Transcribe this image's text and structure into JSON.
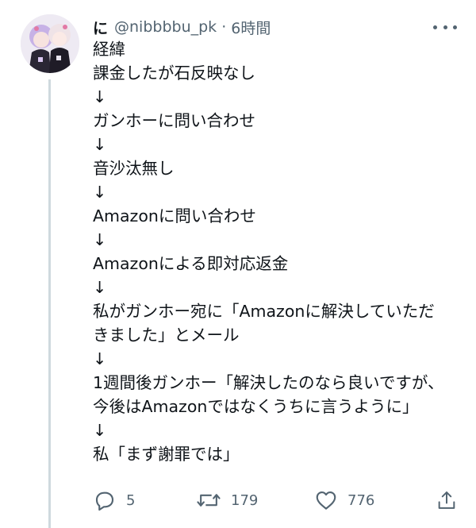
{
  "tweet": {
    "display_name": "に",
    "handle": "@nibbbbu_pk",
    "separator": "·",
    "time": "6時間",
    "body_lines": [
      "経緯",
      "課金したが石反映なし",
      "↓",
      "ガンホーに問い合わせ",
      "↓",
      "音沙汰無し",
      "↓",
      "Amazonに問い合わせ",
      "↓",
      "Amazonによる即対応返金",
      "↓",
      "私がガンホー宛に「Amazonに解決していただ",
      "きました」とメール",
      "↓",
      "1週間後ガンホー「解決したのなら良いですが、",
      "今後はAmazonではなくうちに言うように」",
      "↓",
      "私「まず謝罪では」"
    ],
    "actions": {
      "reply_count": "5",
      "retweet_count": "179",
      "like_count": "776"
    }
  },
  "icons": {
    "more": "more-horizontal-icon",
    "reply": "reply-icon",
    "retweet": "retweet-icon",
    "like": "heart-icon",
    "share": "share-icon"
  },
  "colors": {
    "text": "#0f1419",
    "secondary": "#536471",
    "thread_line": "#cfd9de"
  }
}
